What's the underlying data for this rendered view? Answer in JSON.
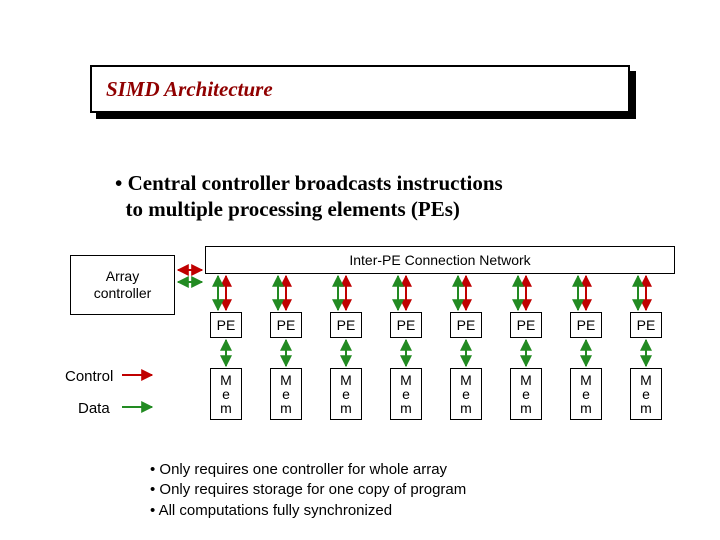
{
  "title": "SIMD Architecture",
  "bullet_main_line1": "• Central controller broadcasts instructions",
  "bullet_main_line2": "to multiple processing elements (PEs)",
  "diagram": {
    "array_controller": "Array\ncontroller",
    "inter_pe": "Inter-PE Connection Network",
    "pe_label": "PE",
    "mem_label": "M\ne\nm",
    "pe_count": 8,
    "legend_control": "Control",
    "legend_data": "Data",
    "colors": {
      "control": "#c00000",
      "data": "#228b22"
    }
  },
  "notes": [
    "• Only requires one controller for whole array",
    "• Only requires storage for one copy of program",
    "• All computations fully synchronized"
  ]
}
